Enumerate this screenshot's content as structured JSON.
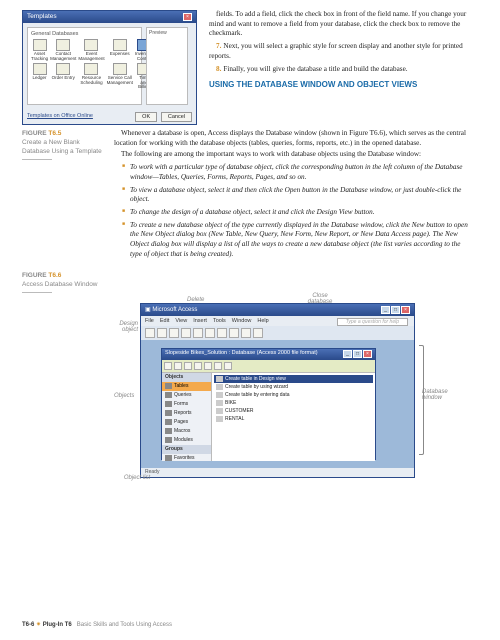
{
  "templates_dialog": {
    "title": "Templates",
    "tabs": "General   Databases",
    "icons": [
      {
        "label": "Asset Tracking"
      },
      {
        "label": "Contact Management"
      },
      {
        "label": "Event Management"
      },
      {
        "label": "Expenses"
      },
      {
        "label": "Inventory Control"
      },
      {
        "label": "Ledger"
      },
      {
        "label": "Order Entry"
      },
      {
        "label": "Resource Scheduling"
      },
      {
        "label": "Service Call Management"
      },
      {
        "label": "Time and Billing"
      }
    ],
    "preview_label": "Preview",
    "link": "Templates on Office Online",
    "ok": "OK",
    "cancel": "Cancel"
  },
  "para1": "fields. To add a field, click the check box in front of the field name. If you change your mind and want to remove a field from your database, click the check box to remove the checkmark.",
  "step7": "Next, you will select a graphic style for screen display and another style for printed reports.",
  "step8": "Finally, you will give the database a title and build the database.",
  "section_title": "USING THE DATABASE WINDOW AND OBJECT VIEWS",
  "fig65": {
    "num": "FIGURE ",
    "code": "T6.5",
    "caption": "Create a New Blank Database Using a Template"
  },
  "main1": "Whenever a database is open, Access displays the Database window (shown in Figure T6.6), which serves as the central location for working with the database objects (tables, queries, forms, reports, etc.) in the opened database.",
  "main2": "The following are among the important ways to work with database objects using the Database window:",
  "b1": "To work with a particular type of database object, click the corresponding button in the left column of the Database window—Tables, Queries, Forms, Reports, Pages, and so on.",
  "b2": "To view a database object, select it and then click the Open button in the Database window, or just double-click the object.",
  "b3": "To change the design of a database object, select it and click the Design View button.",
  "b4": "To create a new database object of the type currently displayed in the Database window, click the New button to open the New Object dialog box (New Table, New Query, New Form, New Report, or New Data Access page). The New Object dialog box will display a list of all the ways to create a new database object (the list varies according to the type of object that is being created).",
  "fig66": {
    "num": "FIGURE ",
    "code": "T6.6",
    "caption": "Access Database Window"
  },
  "callouts": {
    "design_object": "Design object",
    "delete": "Delete",
    "close_db": "Close database",
    "objects": "Objects",
    "object_list": "Object list",
    "db_window": "Database window"
  },
  "access_window": {
    "title": "Microsoft Access",
    "menu": [
      "File",
      "Edit",
      "View",
      "Insert",
      "Tools",
      "Window",
      "Help"
    ],
    "help_prompt": "Type a question for help",
    "db_title": "Slopeside Bikes_Solution : Database (Access 2000 file format)",
    "obj_header": "Objects",
    "objects": [
      "Tables",
      "Queries",
      "Forms",
      "Reports",
      "Pages",
      "Macros",
      "Modules"
    ],
    "groups_header": "Groups",
    "groups": [
      "Favorites"
    ],
    "list": [
      "Create table in Design view",
      "Create table by using wizard",
      "Create table by entering data",
      "BIKE",
      "CUSTOMER",
      "RENTAL"
    ],
    "status": "Ready"
  },
  "footer": {
    "page": "T6-6",
    "plug": "Plug-In T6",
    "rest": "Basic Skills and Tools Using Access"
  }
}
